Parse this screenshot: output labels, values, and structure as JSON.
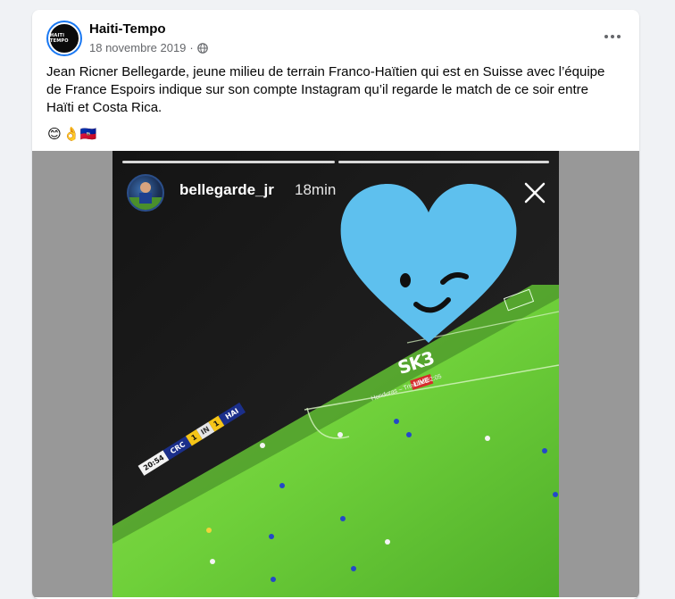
{
  "post": {
    "page_name": "Haiti-Tempo",
    "avatar_text": "HAITI TEMPO",
    "date": "18 novembre 2019",
    "separator": "·",
    "privacy_icon": "globe-icon",
    "more_icon": "more-horizontal-icon",
    "text": "Jean Ricner Bellegarde, jeune milieu de terrain Franco-Haïtien qui est en Suisse avec l’équipe de France Espoirs indique sur son compte Instagram qu’il regarde le match de ce soir entre Haïti et Costa Rica.",
    "emojis": [
      "😊",
      "👌",
      "🇭🇹"
    ]
  },
  "story": {
    "username": "bellegarde_jr",
    "time": "18min",
    "progress_segments": 2,
    "close_icon": "close-icon",
    "sticker": "winking-heart-sticker",
    "sticker_color": "#5ec0ee"
  },
  "broadcast": {
    "channel": "SK3",
    "live": "LIVE",
    "caption": "Honduras – Trinidad 02:05",
    "scoreboard": {
      "time": "20:54",
      "home": "CRC",
      "home_score": "1",
      "separator": "IN",
      "away_score": "1",
      "away": "HAI"
    }
  },
  "colors": {
    "accent": "#1877f2",
    "pitch": "#6fd03a",
    "card_background": "#ffffff",
    "page_background": "#f0f2f5"
  }
}
